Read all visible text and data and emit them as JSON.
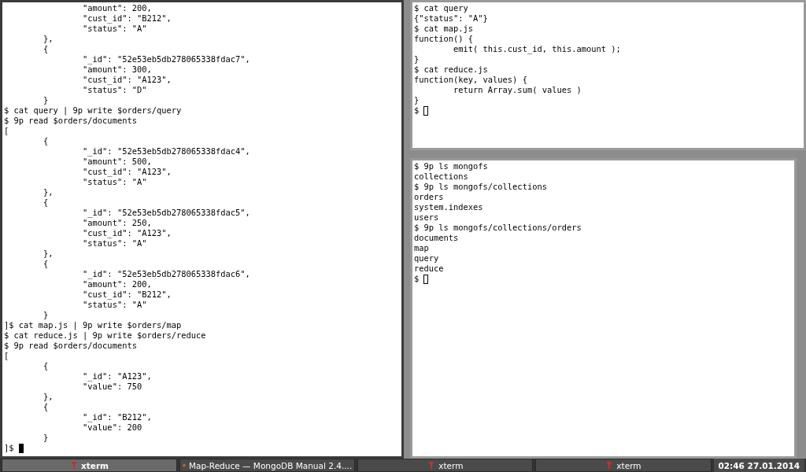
{
  "terminals": [
    {
      "focused": true,
      "cursor_filled": true,
      "lines": [
        "\t\t\"amount\": 200,",
        "\t\t\"cust_id\": \"B212\",",
        "\t\t\"status\": \"A\"",
        "\t},",
        "\t{",
        "\t\t\"_id\": \"52e53eb5db278065338fdac7\",",
        "\t\t\"amount\": 300,",
        "\t\t\"cust_id\": \"A123\",",
        "\t\t\"status\": \"D\"",
        "\t}",
        "$ cat query | 9p write $orders/query",
        "$ 9p read $orders/documents",
        "[",
        "\t{",
        "\t\t\"_id\": \"52e53eb5db278065338fdac4\",",
        "\t\t\"amount\": 500,",
        "\t\t\"cust_id\": \"A123\",",
        "\t\t\"status\": \"A\"",
        "\t},",
        "\t{",
        "\t\t\"_id\": \"52e53eb5db278065338fdac5\",",
        "\t\t\"amount\": 250,",
        "\t\t\"cust_id\": \"A123\",",
        "\t\t\"status\": \"A\"",
        "\t},",
        "\t{",
        "\t\t\"_id\": \"52e53eb5db278065338fdac6\",",
        "\t\t\"amount\": 200,",
        "\t\t\"cust_id\": \"B212\",",
        "\t\t\"status\": \"A\"",
        "\t}",
        "]$ cat map.js | 9p write $orders/map",
        "$ cat reduce.js | 9p write $orders/reduce",
        "$ 9p read $orders/documents",
        "[",
        "\t{",
        "\t\t\"_id\": \"A123\",",
        "\t\t\"value\": 750",
        "\t},",
        "\t{",
        "\t\t\"_id\": \"B212\",",
        "\t\t\"value\": 200",
        "\t}",
        "]$"
      ]
    },
    {
      "focused": false,
      "cursor_filled": false,
      "lines": [
        "$ cat query",
        "{\"status\": \"A\"}",
        "$ cat map.js",
        "function() {",
        "\temit( this.cust_id, this.amount );",
        "}",
        "$ cat reduce.js",
        "function(key, values) {",
        "\treturn Array.sum( values )",
        "}",
        "$"
      ]
    },
    {
      "focused": false,
      "cursor_filled": false,
      "lines": [
        "$ 9p ls mongofs",
        "collections",
        "$ 9p ls mongofs/collections",
        "orders",
        "system.indexes",
        "users",
        "$ 9p ls mongofs/collections/orders",
        "documents",
        "map",
        "query",
        "reduce",
        "$"
      ]
    }
  ],
  "taskbar": {
    "tasks": [
      {
        "label": "xterm",
        "kind": "terminal",
        "selected": true
      },
      {
        "label": "Map-Reduce — MongoDB Manual 2.4....",
        "kind": "browser",
        "selected": false
      },
      {
        "label": "xterm",
        "kind": "terminal",
        "selected": false
      },
      {
        "label": "xterm",
        "kind": "terminal",
        "selected": false
      }
    ],
    "clock": "02:46 27.01.2014"
  }
}
